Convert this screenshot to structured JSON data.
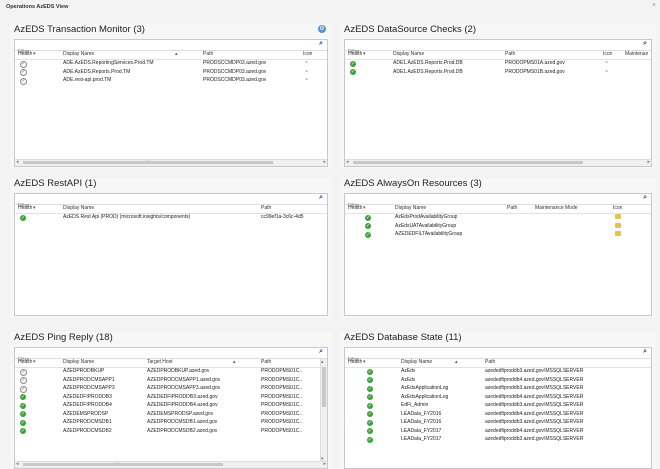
{
  "window": {
    "title": "Operations AzEDS View",
    "close": "×"
  },
  "filter_placeholder": "Filter",
  "panels": {
    "tm": {
      "title": "AzEDS Transaction Monitor (3)",
      "cols": [
        "Health",
        "Display Name",
        "Path",
        "Icon"
      ],
      "rows": [
        {
          "health": "gray",
          "name": "ADE.AzEDS.ReportingServices.Prod.TM",
          "path": "PRODSCCMDP03.azed.gov",
          "icon": "~"
        },
        {
          "health": "gray",
          "name": "ADE.AzEDS.Reports.Prod.TM",
          "path": "PRODSCCMDP03.azed.gov",
          "icon": "~"
        },
        {
          "health": "gray",
          "name": "ADE.rest-api.prod.TM",
          "path": "PRODSCCMDP03.azed.gov",
          "icon": "~"
        }
      ]
    },
    "ds": {
      "title": "AzEDS DataSource Checks (2)",
      "cols": [
        "Health",
        "Display Name",
        "Path",
        "Icon",
        "Maintenan"
      ],
      "rows": [
        {
          "health": "green",
          "name": "ADE1.AzEDS.Reports.Prod.DB",
          "path": "PRODOPMS01A.azed.gov",
          "icon": "~"
        },
        {
          "health": "green",
          "name": "ADE1.AzEDS.Reports.Prod.DB",
          "path": "PRODOPMS01B.azed.gov",
          "icon": "~"
        }
      ]
    },
    "api": {
      "title": "AzEDS RestAPI (1)",
      "cols": [
        "Health",
        "Display Name",
        "Path"
      ],
      "rows": [
        {
          "health": "green",
          "name": "AzEDS Rest Api (PROD) (microsoft.insights/components)",
          "path": "cc99ef1a-3c6c-4d5"
        }
      ]
    },
    "ao": {
      "title": "AzEDS AlwaysOn Resources (3)",
      "cols": [
        "Health",
        "Display Name",
        "Path",
        "Maintenance Mode",
        "Icon"
      ],
      "rows": [
        {
          "health": "green",
          "name": "AzEdsProdAvailabilityGroup"
        },
        {
          "health": "green",
          "name": "AzEdsUATAvailabilityGroup"
        },
        {
          "health": "green",
          "name": "AZEDEDFILTAvailabilityGroup"
        }
      ]
    },
    "ping": {
      "title": "AzEDS Ping Reply (18)",
      "cols": [
        "Health",
        "Display Name",
        "Target Host",
        "Path"
      ],
      "rows": [
        {
          "health": "gray",
          "name": "AZEDPRODBKUP",
          "host": "AZEDPRODBKUP.azed.gov",
          "path": "PRODOPMS01C.."
        },
        {
          "health": "gray",
          "name": "AZEDPRODCMSAPP1",
          "host": "AZEDPRODCMSAPP1.azed.gov",
          "path": "PRODOPMS01C.."
        },
        {
          "health": "gray",
          "name": "AZEDPRODCMSAPP3",
          "host": "AZEDPRODCMSAPP3.azed.gov",
          "path": "PRODOPMS01C.."
        },
        {
          "health": "green",
          "name": "AZEDEDFIPRODDB3",
          "host": "AZEDEDFIPRODDB3.azed.gov",
          "path": "PRODOPMS01C.."
        },
        {
          "health": "green",
          "name": "AZEDEDFIPRODDB4",
          "host": "AZEDEDFIPRODDB4.azed.gov",
          "path": "PRODOPMS01C.."
        },
        {
          "health": "green",
          "name": "AZEDEMSPRODSP",
          "host": "AZEDEMSPRODSP.azed.gov",
          "path": "PRODOPMS01C.."
        },
        {
          "health": "green",
          "name": "AZEDPRODCMSDB1",
          "host": "AZEDPRODCMSDB1.azed.gov",
          "path": "PRODOPMS01C.."
        },
        {
          "health": "green",
          "name": "AZEDPRODCMSDB2",
          "host": "AZEDPRODCMSDB2.azed.gov",
          "path": "PRODOPMS01C.."
        }
      ]
    },
    "dbs": {
      "title": "AzEDS Database State (11)",
      "cols": [
        "Health",
        "Display Name",
        "Path"
      ],
      "rows": [
        {
          "health": "green",
          "name": "AzEds",
          "path": "azededfiproddb3.azed.gov\\MSSQLSERVER"
        },
        {
          "health": "green",
          "name": "AzEds",
          "path": "azededfiproddb4.azed.gov\\MSSQLSERVER"
        },
        {
          "health": "green",
          "name": "AzEdsApplicationLog",
          "path": "azededfiproddb3.azed.gov\\MSSQLSERVER"
        },
        {
          "health": "green",
          "name": "AzEdsApplicationLog",
          "path": "azededfiproddb4.azed.gov\\MSSQLSERVER"
        },
        {
          "health": "green",
          "name": "EdFi_Admin",
          "path": "azededfiproddb3.azed.gov\\MSSQLSERVER"
        },
        {
          "health": "green",
          "name": "LEAData_FY2016",
          "path": "azededfiproddb4.azed.gov\\MSSQLSERVER"
        },
        {
          "health": "green",
          "name": "LEAData_FY2016",
          "path": "azededfiproddb3.azed.gov\\MSSQLSERVER"
        },
        {
          "health": "green",
          "name": "LEAData_FY2017",
          "path": "azededfiproddb4.azed.gov\\MSSQLSERVER"
        },
        {
          "health": "green",
          "name": "LEAData_FY2017",
          "path": "azededfiproddb3.azed.gov\\MSSQLSERVER"
        }
      ]
    }
  }
}
